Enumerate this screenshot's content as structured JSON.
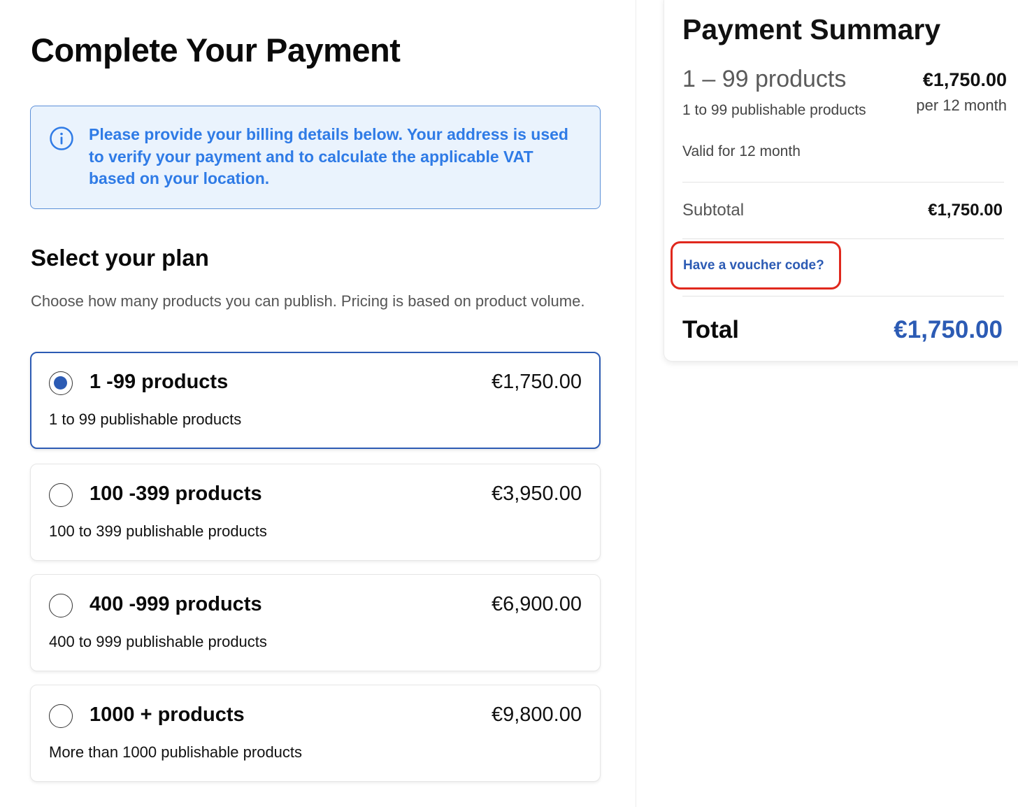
{
  "page": {
    "title": "Complete Your Payment"
  },
  "info_box": {
    "icon": "info-circle-icon",
    "text": "Please provide your billing details below. Your address is used to verify your payment and to calculate the applicable VAT based on your location.",
    "color": "#2f7be6"
  },
  "plans_section": {
    "title": "Select your plan",
    "description": "Choose how many products you can publish. Pricing is based on product volume.",
    "plans": [
      {
        "name": "1 -99 products",
        "price": "€1,750.00",
        "description": "1 to 99 publishable products",
        "selected": true
      },
      {
        "name": "100 -399 products",
        "price": "€3,950.00",
        "description": "100 to 399 publishable products",
        "selected": false
      },
      {
        "name": "400 -999 products",
        "price": "€6,900.00",
        "description": "400 to 999 publishable products",
        "selected": false
      },
      {
        "name": "1000 + products",
        "price": "€9,800.00",
        "description": "More than 1000 publishable products",
        "selected": false
      }
    ]
  },
  "summary": {
    "title": "Payment Summary",
    "plan_name": "1 – 99 products",
    "plan_description": "1 to 99 publishable products",
    "price": "€1,750.00",
    "period": "per 12 month",
    "validity": "Valid for 12 month",
    "subtotal_label": "Subtotal",
    "subtotal_value": "€1,750.00",
    "voucher_link": "Have a voucher code?",
    "total_label": "Total",
    "total_value": "€1,750.00"
  },
  "colors": {
    "accent": "#2c5bb4",
    "highlight": "#e0281d"
  }
}
